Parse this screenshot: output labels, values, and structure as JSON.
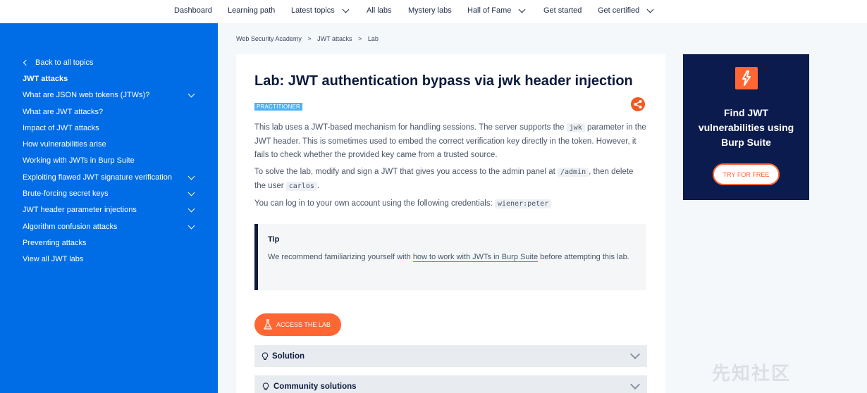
{
  "topnav": {
    "items": [
      {
        "label": "Dashboard",
        "dropdown": false
      },
      {
        "label": "Learning path",
        "dropdown": false
      },
      {
        "label": "Latest topics",
        "dropdown": true
      },
      {
        "label": "All labs",
        "dropdown": false
      },
      {
        "label": "Mystery labs",
        "dropdown": false
      },
      {
        "label": "Hall of Fame",
        "dropdown": true
      },
      {
        "label": "Get started",
        "dropdown": false
      },
      {
        "label": "Get certified",
        "dropdown": true
      }
    ]
  },
  "sidebar": {
    "back": "Back to all topics",
    "heading": "JWT attacks",
    "items": [
      {
        "label": "What are JSON web tokens (JTWs)?",
        "expandable": true
      },
      {
        "label": "What are JWT attacks?",
        "expandable": false
      },
      {
        "label": "Impact of JWT attacks",
        "expandable": false
      },
      {
        "label": "How vulnerabilities arise",
        "expandable": false
      },
      {
        "label": "Working with JWTs in Burp Suite",
        "expandable": false
      },
      {
        "label": "Exploiting flawed JWT signature verification",
        "expandable": true
      },
      {
        "label": "Brute-forcing secret keys",
        "expandable": true
      },
      {
        "label": "JWT header parameter injections",
        "expandable": true
      },
      {
        "label": "Algorithm confusion attacks",
        "expandable": true
      },
      {
        "label": "Preventing attacks",
        "expandable": false
      },
      {
        "label": "View all JWT labs",
        "expandable": false
      }
    ]
  },
  "breadcrumb": [
    "Web Security Academy",
    ">",
    "JWT attacks",
    ">",
    "Lab"
  ],
  "lab": {
    "title": "Lab: JWT authentication bypass via jwk header injection",
    "level": "PRACTITIONER",
    "p1": {
      "a": "This lab uses a JWT-based mechanism for handling sessions. The server supports the ",
      "code": "jwk",
      "b": " parameter in the JWT header. This is sometimes used to embed the correct verification key directly in the token. However, it fails to check whether the provided key came from a trusted source."
    },
    "p2": {
      "a": "To solve the lab, modify and sign a JWT that gives you access to the admin panel at ",
      "code1": "/admin",
      "b": ", then delete the user ",
      "code2": "carlos",
      "c": "."
    },
    "p3": {
      "a": "You can log in to your own account using the following credentials: ",
      "code": "wiener:peter"
    },
    "tip": {
      "title": "Tip",
      "a": "We recommend familiarizing yourself with ",
      "link": "how to work with JWTs in Burp Suite",
      "b": " before attempting this lab."
    },
    "access_button": "ACCESS THE LAB",
    "solution": "Solution",
    "community": "Community solutions"
  },
  "promo": {
    "text": "Find JWT vulnerabilities using Burp Suite",
    "button": "TRY FOR FREE"
  },
  "watermark": "先知社区",
  "colors": {
    "sidebar": "#006ce6",
    "accent": "#ff6633",
    "badge": "#4db1f5",
    "promo_bg": "#0b1b4d"
  }
}
